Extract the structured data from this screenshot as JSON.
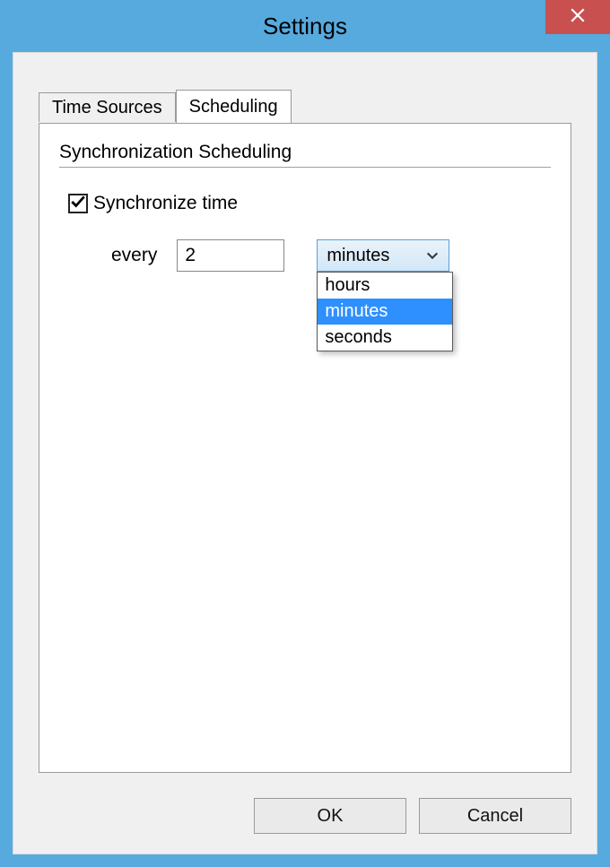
{
  "window": {
    "title": "Settings"
  },
  "tabs": {
    "time_sources": "Time Sources",
    "scheduling": "Scheduling"
  },
  "section": {
    "heading": "Synchronization Scheduling"
  },
  "sync": {
    "checkbox_checked": true,
    "label": "Synchronize time",
    "every_label": "every",
    "interval_value": "2"
  },
  "unit": {
    "selected": "minutes",
    "options": {
      "hours": "hours",
      "minutes": "minutes",
      "seconds": "seconds"
    }
  },
  "buttons": {
    "ok": "OK",
    "cancel": "Cancel"
  }
}
